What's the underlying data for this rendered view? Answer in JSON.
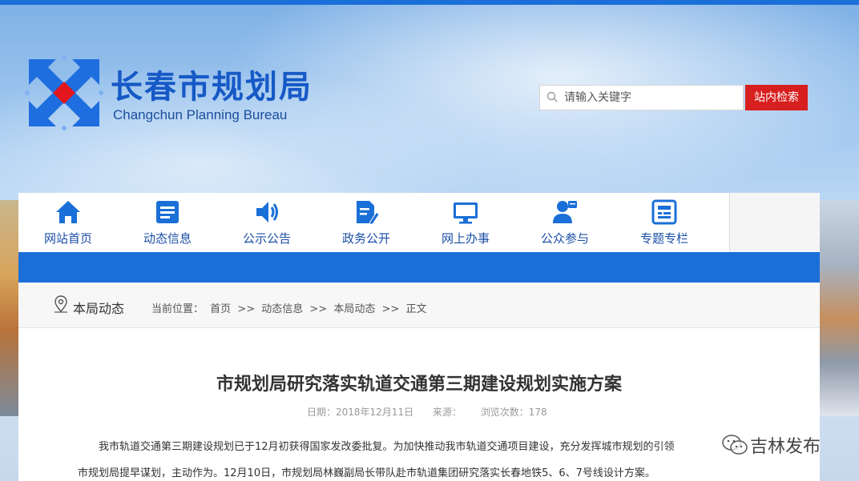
{
  "site": {
    "name_cn": "长春市规划局",
    "name_en": "Changchun Planning Bureau",
    "colors": {
      "primary_blue": "#1a6fd8",
      "search_red": "#d81f1f",
      "logo_red": "#e3161e"
    }
  },
  "search": {
    "placeholder": "请输入关键字",
    "button_label": "站内检索",
    "icon": "search-icon"
  },
  "nav": {
    "items": [
      {
        "label": "网站首页",
        "icon": "home-icon"
      },
      {
        "label": "动态信息",
        "icon": "news-icon"
      },
      {
        "label": "公示公告",
        "icon": "speaker-icon"
      },
      {
        "label": "政务公开",
        "icon": "document-edit-icon"
      },
      {
        "label": "网上办事",
        "icon": "monitor-icon"
      },
      {
        "label": "公众参与",
        "icon": "user-service-icon"
      },
      {
        "label": "专题专栏",
        "icon": "topic-board-icon"
      }
    ]
  },
  "breadcrumb": {
    "section": "本局动态",
    "prefix": "当前位置：",
    "items": [
      "首页",
      ">>",
      "动态信息",
      ">>",
      "本局动态",
      ">>",
      "正文"
    ]
  },
  "article": {
    "title": "市规划局研究落实轨道交通第三期建设规划实施方案",
    "date": "日期：2018年12月11日",
    "source": "来源：",
    "views": "浏览次数：178",
    "para1": "我市轨道交通第三期建设规划已于12月初获得国家发改委批复。为加快推动我市轨道交通项目建设，充分发挥城市规划的引领",
    "para2": "市规划局提早谋划，主动作为。12月10日，市规划局林巍副局长带队赴市轨道集团研究落实长春地铁5、6、7号线设计方案。"
  },
  "watermark": {
    "text": "吉林发布",
    "icon": "wechat-icon"
  }
}
